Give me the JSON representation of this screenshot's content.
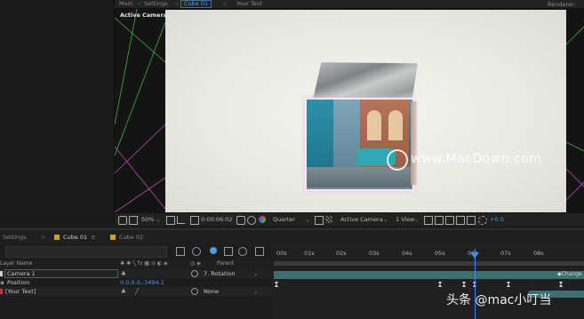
{
  "tabs": {
    "main": "Main",
    "settings": "Settings",
    "cube": "Cube 01",
    "your_text": "Your Text"
  },
  "viewer": {
    "active_camera": "Active Camera",
    "renderer": "Renderer:"
  },
  "watermark": "www.MacDown.com",
  "toolbar": {
    "zoom": "50%",
    "timecode": "0:00:06:02",
    "resolution": "Quarter",
    "camera": "Active Camera",
    "view": "1 View",
    "exposure": "+0.0"
  },
  "timeline": {
    "tab_settings": "Settings",
    "tab_cube01": "Cube 01",
    "tab_cube02": "Cube 02",
    "col_layer_name": "Layer Name",
    "col_parent": "Parent",
    "layers": [
      {
        "name": "Camera 1",
        "parent": "7. Rotation"
      },
      {
        "name": "Position",
        "value": "0.0,0.0,-3494.1"
      },
      {
        "name": "[Your Text]",
        "parent": "None"
      }
    ],
    "ruler": [
      "00s",
      "01s",
      "02s",
      "03s",
      "04s",
      "05s",
      "06s",
      "07s",
      "08s"
    ],
    "marker": "Change"
  },
  "colors": {
    "accent": "#3d8bf0",
    "tab_swatch_cube": "#c9a227",
    "layer_bar": "#3d6e70"
  },
  "credit": "头条 @mac小叮当"
}
